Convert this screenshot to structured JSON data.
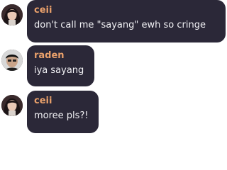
{
  "colors": {
    "bubble_bg": "#2b2838",
    "text": "#f2f2f5",
    "username_ceii": "#e9a06b",
    "username_raden": "#e9a06b"
  },
  "messages": [
    {
      "username": "ceii",
      "text": "don't call me \"sayang\" ewh so cringe",
      "avatar_icon": "user-avatar-photo"
    },
    {
      "username": "raden",
      "text": "iya sayang",
      "avatar_icon": "user-avatar-photo"
    },
    {
      "username": "ceii",
      "text": "moree pls?!",
      "avatar_icon": "user-avatar-photo"
    }
  ]
}
